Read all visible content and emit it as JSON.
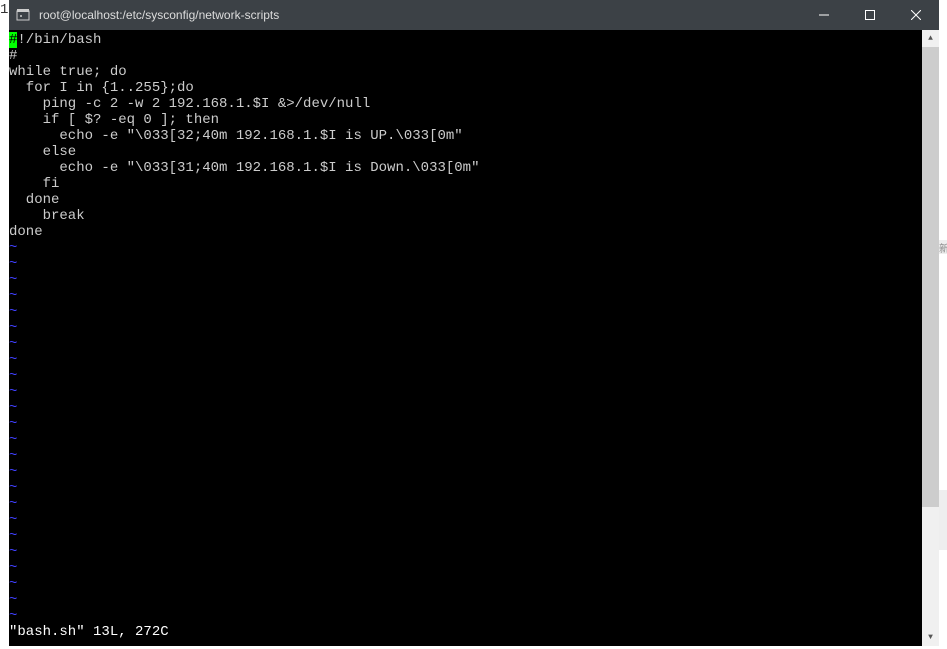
{
  "gutter": {
    "line_number": "1"
  },
  "titlebar": {
    "title": "root@localhost:/etc/sysconfig/network-scripts"
  },
  "editor": {
    "shebang_highlight": "#",
    "shebang_rest": "!/bin/bash",
    "lines": [
      "#",
      "while true; do",
      "  for I in {1..255};do",
      "    ping -c 2 -w 2 192.168.1.$I &>/dev/null",
      "    if [ $? -eq 0 ]; then",
      "      echo -e \"\\033[32;40m 192.168.1.$I is UP.\\033[0m\"",
      "    else",
      "      echo -e \"\\033[31;40m 192.168.1.$I is Down.\\033[0m\"",
      "    fi",
      "  done",
      "    break",
      "done"
    ],
    "tilde": "~",
    "tilde_count": 24,
    "status": "\"bash.sh\" 13L, 272C"
  },
  "right_marks": [
    "新",
    ""
  ]
}
